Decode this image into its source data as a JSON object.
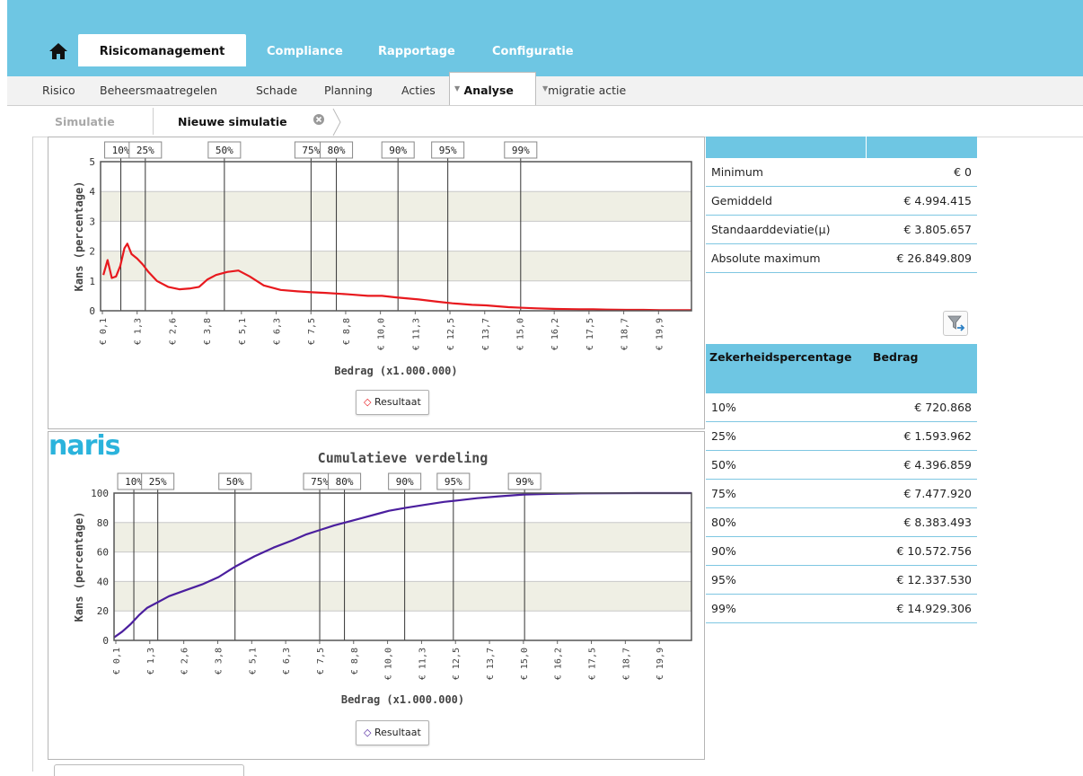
{
  "main_tabs": {
    "risico": "Risicomanagement",
    "compliance": "Compliance",
    "rapportage": "Rapportage",
    "configuratie": "Configuratie"
  },
  "sub_nav": {
    "risico": "Risico",
    "beheers": "Beheersmaatregelen",
    "schade": "Schade",
    "planning": "Planning",
    "acties": "Acties",
    "analyse": "Analyse",
    "migratie": "migratie actie"
  },
  "breadcrumb": {
    "simulatie": "Simulatie",
    "nieuwe": "Nieuwe simulatie"
  },
  "logo_text": "naris",
  "stats": [
    {
      "label": "Minimum",
      "value": "€ 0"
    },
    {
      "label": "Gemiddeld",
      "value": "€ 4.994.415"
    },
    {
      "label": "Standaarddeviatie(µ)",
      "value": "€ 3.805.657"
    },
    {
      "label": "Absolute maximum",
      "value": "€ 26.849.809"
    }
  ],
  "percentiles": {
    "header_pct": "Zekerheidspercentage",
    "header_amount": "Bedrag",
    "rows": [
      {
        "pct": "10%",
        "amount": "€ 720.868"
      },
      {
        "pct": "25%",
        "amount": "€ 1.593.962"
      },
      {
        "pct": "50%",
        "amount": "€ 4.396.859"
      },
      {
        "pct": "75%",
        "amount": "€ 7.477.920"
      },
      {
        "pct": "80%",
        "amount": "€ 8.383.493"
      },
      {
        "pct": "90%",
        "amount": "€ 10.572.756"
      },
      {
        "pct": "95%",
        "amount": "€ 12.337.530"
      },
      {
        "pct": "99%",
        "amount": "€ 14.929.306"
      }
    ]
  },
  "colors": {
    "accent": "#6ec6e3",
    "series1": "#e8191e",
    "series2": "#4b1f9e"
  },
  "chart_data": [
    {
      "type": "line",
      "title": "",
      "xlabel": "Bedrag (x1.000.000)",
      "ylabel": "Kans (percentage)",
      "ylim": [
        0,
        5
      ],
      "xlim": [
        0,
        21
      ],
      "yticks": [
        0,
        1,
        2,
        3,
        4,
        5
      ],
      "xtick_labels": [
        "€ 0,1",
        "€ 1,3",
        "€ 2,6",
        "€ 3,8",
        "€ 5,1",
        "€ 6,3",
        "€ 7,5",
        "€ 8,8",
        "€ 10,0",
        "€ 11,3",
        "€ 12,5",
        "€ 13,7",
        "€ 15,0",
        "€ 16,2",
        "€ 17,5",
        "€ 18,7",
        "€ 19,9"
      ],
      "markers": [
        {
          "label": "10%",
          "x": 0.72
        },
        {
          "label": "25%",
          "x": 1.59
        },
        {
          "label": "50%",
          "x": 4.4
        },
        {
          "label": "75%",
          "x": 7.48
        },
        {
          "label": "80%",
          "x": 8.38
        },
        {
          "label": "90%",
          "x": 10.57
        },
        {
          "label": "95%",
          "x": 12.34
        },
        {
          "label": "99%",
          "x": 14.93
        }
      ],
      "series": [
        {
          "name": "Resultaat",
          "color": "#e8191e",
          "x": [
            0.1,
            0.25,
            0.4,
            0.55,
            0.7,
            0.85,
            0.95,
            1.1,
            1.3,
            1.5,
            1.7,
            2.0,
            2.4,
            2.8,
            3.2,
            3.5,
            3.8,
            4.1,
            4.5,
            4.9,
            5.3,
            5.8,
            6.4,
            7.0,
            7.5,
            8.0,
            8.8,
            9.5,
            10.0,
            10.5,
            11.3,
            12.0,
            12.5,
            13.2,
            13.7,
            14.5,
            15.0,
            15.5,
            16.2,
            17.0,
            17.5,
            18.0,
            18.7,
            19.3,
            19.9,
            20.5,
            21.0
          ],
          "y": [
            1.2,
            1.7,
            1.1,
            1.15,
            1.5,
            2.1,
            2.25,
            1.9,
            1.75,
            1.55,
            1.3,
            1.0,
            0.8,
            0.72,
            0.75,
            0.8,
            1.05,
            1.2,
            1.3,
            1.35,
            1.15,
            0.85,
            0.7,
            0.65,
            0.62,
            0.6,
            0.55,
            0.5,
            0.5,
            0.45,
            0.38,
            0.3,
            0.25,
            0.2,
            0.18,
            0.12,
            0.1,
            0.08,
            0.06,
            0.05,
            0.05,
            0.04,
            0.03,
            0.03,
            0.02,
            0.02,
            0.02
          ]
        }
      ],
      "legend": "bottom"
    },
    {
      "type": "line",
      "title": "Cumulatieve verdeling",
      "xlabel": "Bedrag (x1.000.000)",
      "ylabel": "Kans (percentage)",
      "ylim": [
        0,
        100
      ],
      "xlim": [
        0,
        21
      ],
      "yticks": [
        0,
        20,
        40,
        60,
        80,
        100
      ],
      "xtick_labels": [
        "€ 0,1",
        "€ 1,3",
        "€ 2,6",
        "€ 3,8",
        "€ 5,1",
        "€ 6,3",
        "€ 7,5",
        "€ 8,8",
        "€ 10,0",
        "€ 11,3",
        "€ 12,5",
        "€ 13,7",
        "€ 15,0",
        "€ 16,2",
        "€ 17,5",
        "€ 18,7",
        "€ 19,9"
      ],
      "markers": [
        {
          "label": "10%",
          "x": 0.72
        },
        {
          "label": "25%",
          "x": 1.59
        },
        {
          "label": "50%",
          "x": 4.4
        },
        {
          "label": "75%",
          "x": 7.48
        },
        {
          "label": "80%",
          "x": 8.38
        },
        {
          "label": "90%",
          "x": 10.57
        },
        {
          "label": "95%",
          "x": 12.34
        },
        {
          "label": "99%",
          "x": 14.93
        }
      ],
      "series": [
        {
          "name": "Resultaat",
          "color": "#4b1f9e",
          "x": [
            0,
            0.3,
            0.6,
            0.9,
            1.2,
            1.6,
            2.0,
            2.6,
            3.2,
            3.8,
            4.4,
            5.1,
            5.8,
            6.5,
            7.0,
            7.5,
            8.0,
            8.4,
            9.0,
            9.6,
            10.0,
            10.6,
            11.3,
            12.0,
            12.5,
            13.2,
            14.0,
            14.9,
            15.5,
            16.2,
            17.0,
            18.0,
            19.0,
            20.0,
            21.0
          ],
          "y": [
            2,
            6,
            11,
            17,
            22,
            26,
            30,
            34,
            38,
            43,
            50,
            57,
            63,
            68,
            72,
            75,
            78,
            80,
            83,
            86,
            88,
            90,
            92,
            94,
            95,
            96.5,
            97.8,
            99,
            99.3,
            99.6,
            99.8,
            99.9,
            100,
            100,
            100
          ]
        }
      ],
      "legend": "bottom"
    }
  ]
}
